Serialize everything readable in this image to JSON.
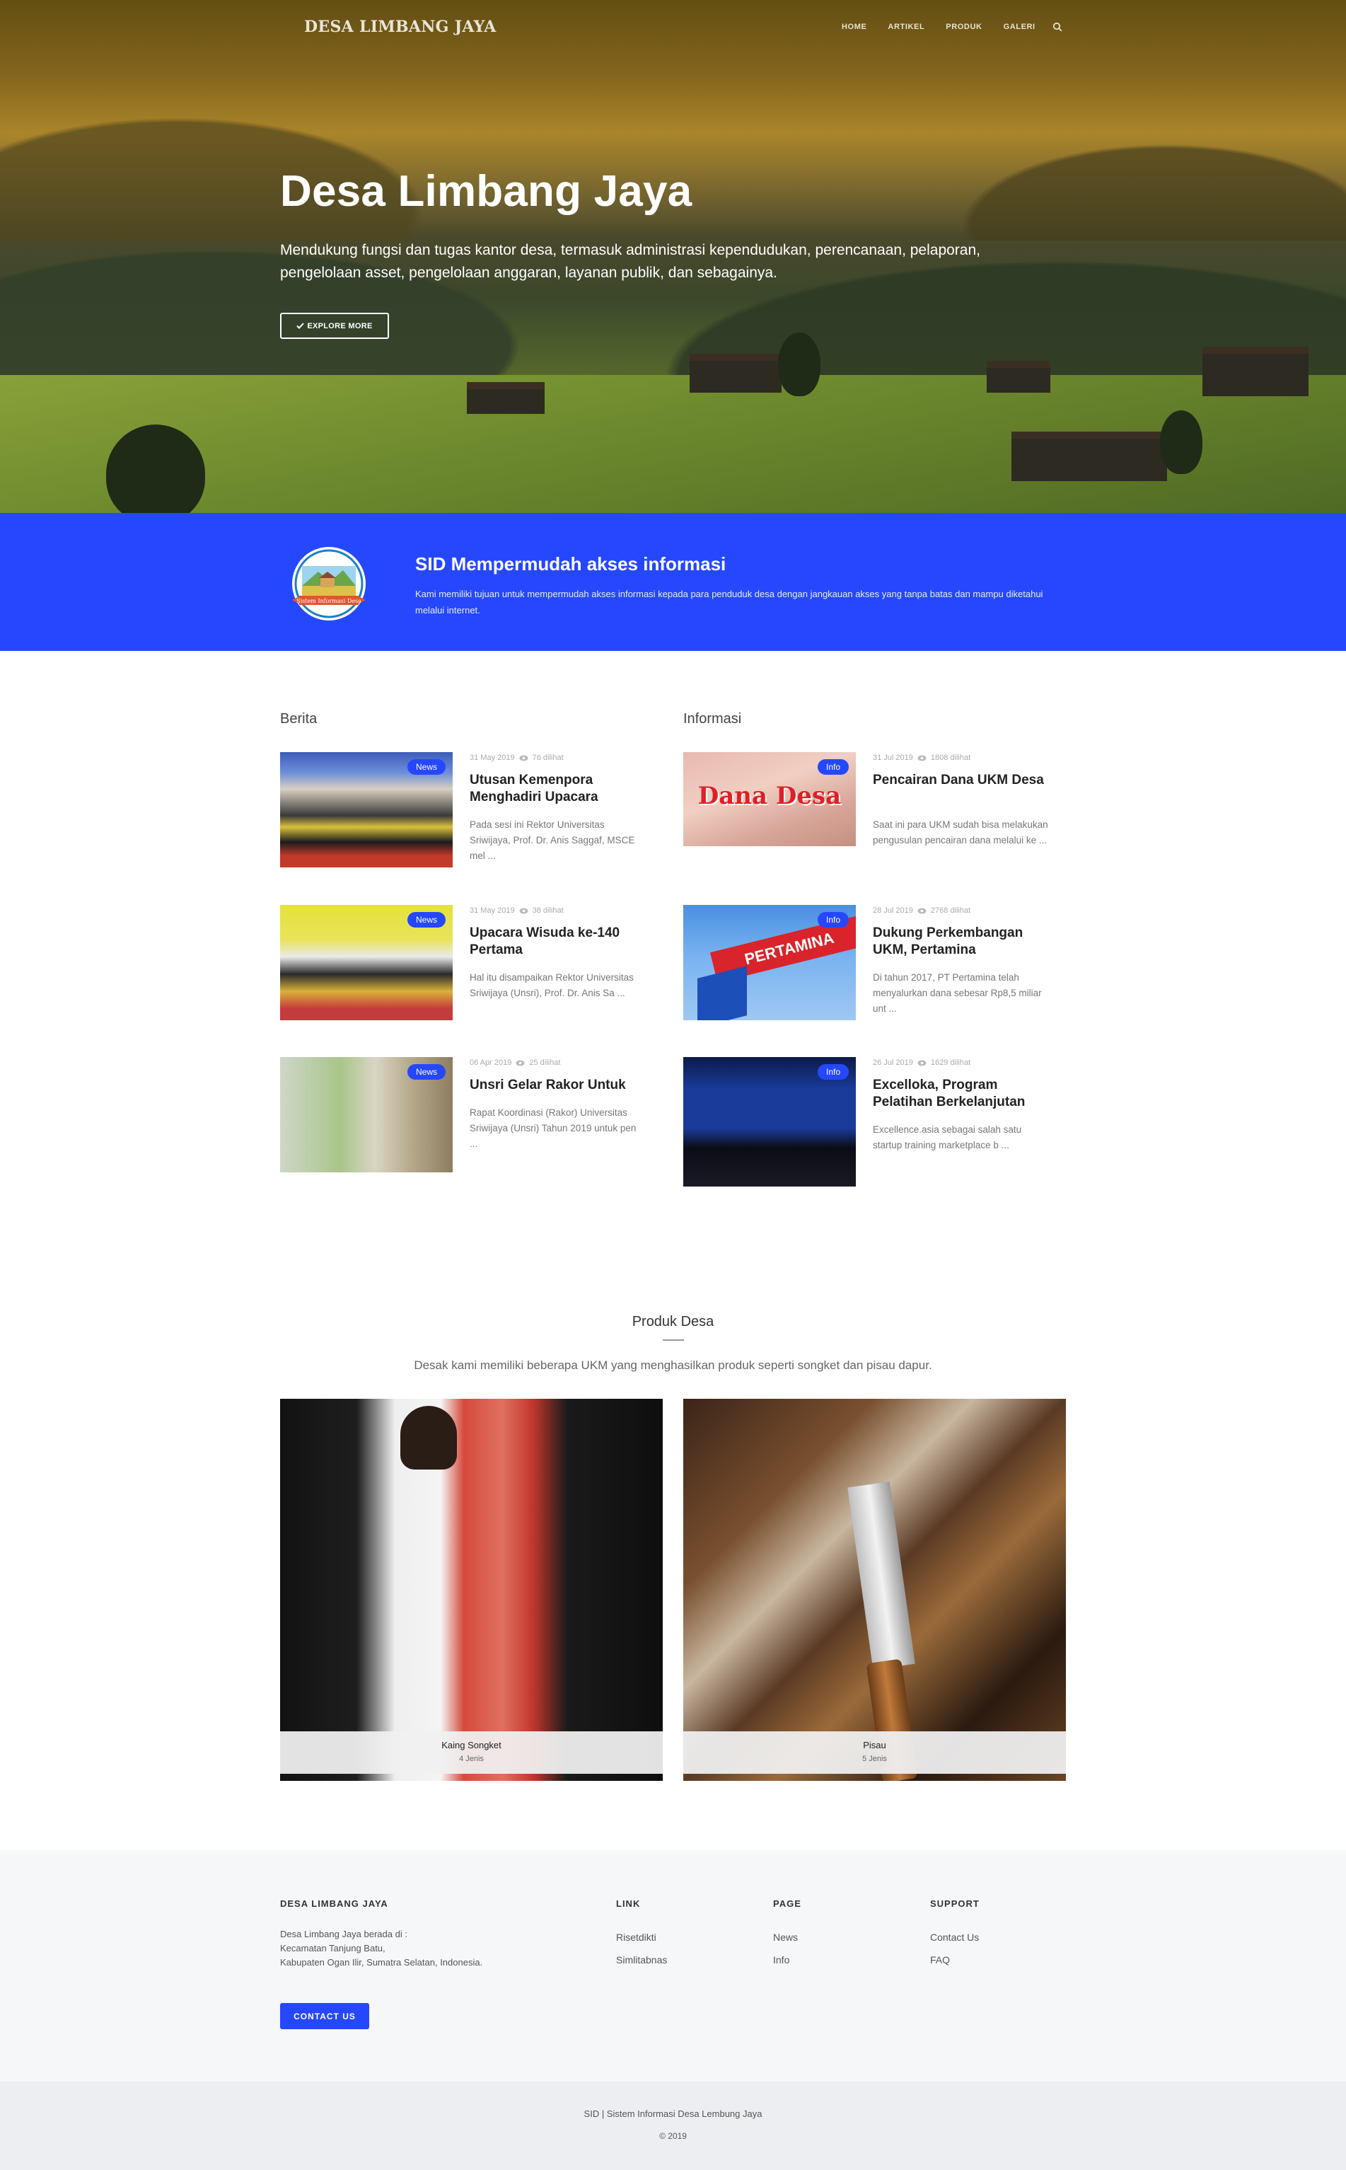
{
  "nav": {
    "brand": "DESA LIMBANG JAYA",
    "items": [
      "HOME",
      "ARTIKEL",
      "PRODUK",
      "GALERI"
    ],
    "search_icon": "search-icon"
  },
  "hero": {
    "title": "Desa Limbang Jaya",
    "text": "Mendukung fungsi dan tugas kantor desa, termasuk administrasi kependudukan, perencanaan, pelaporan, pengelolaan asset, pengelolaan anggaran, layanan publik, dan sebagainya.",
    "button": "EXPLORE MORE",
    "button_icon": "check-icon"
  },
  "band": {
    "title": "SID Mempermudah akses informasi",
    "text": "Kami memiliki tujuan untuk mempermudah akses informasi kepada para penduduk desa dengan jangkauan akses yang tanpa batas dan mampu diketahui melalui internet.",
    "logo_text": "Sistem Informasi Desa",
    "accent": "#2548ff"
  },
  "berita": {
    "heading": "Berita",
    "items": [
      {
        "badge": "News",
        "date": "31 May 2019",
        "views": "76 dilihat",
        "title": "Utusan Kemenpora Menghadiri Upacara",
        "excerpt": "Pada sesi ini Rektor Universitas Sriwijaya, Prof. Dr. Anis Saggaf, MSCE mel ..."
      },
      {
        "badge": "News",
        "date": "31 May 2019",
        "views": "38 dilihat",
        "title": "Upacara Wisuda ke-140 Pertama",
        "excerpt": "Hal itu disampaikan Rektor Universitas Sriwijaya (Unsri), Prof. Dr. Anis Sa ..."
      },
      {
        "badge": "News",
        "date": "06 Apr 2019",
        "views": "25 dilihat",
        "title": "Unsri Gelar Rakor Untuk",
        "excerpt": "Rapat Koordinasi (Rakor) Universitas Sriwijaya (Unsri) Tahun 2019 untuk pen ..."
      }
    ]
  },
  "informasi": {
    "heading": "Informasi",
    "items": [
      {
        "badge": "Info",
        "date": "31 Jul 2019",
        "views": "1808 dilihat",
        "title": "Pencairan Dana UKM Desa",
        "excerpt": "Saat ini para UKM sudah bisa melakukan pengusulan pencairan dana melalui ke ...",
        "image_text": "Dana Desa"
      },
      {
        "badge": "Info",
        "date": "28 Jul 2019",
        "views": "2768 dilihat",
        "title": "Dukung Perkembangan UKM, Pertamina",
        "excerpt": "Di tahun 2017, PT Pertamina telah menyalurkan dana sebesar Rp8,5 miliar unt ...",
        "image_text": "PERTAMINA"
      },
      {
        "badge": "Info",
        "date": "26 Jul 2019",
        "views": "1629 dilihat",
        "title": "Excelloka, Program Pelatihan Berkelanjutan",
        "excerpt": "Excellence.asia sebagai salah satu startup training marketplace b ..."
      }
    ]
  },
  "produk": {
    "title": "Produk Desa",
    "subtitle": "Desak kami memiliki beberapa UKM yang menghasilkan produk seperti songket dan pisau dapur.",
    "items": [
      {
        "name": "Kaing Songket",
        "count": "4 Jenis"
      },
      {
        "name": "Pisau",
        "count": "5 Jenis"
      }
    ]
  },
  "footer": {
    "about_heading": "DESA LIMBANG JAYA",
    "about_lines": [
      "Desa Limbang Jaya berada di :",
      "Kecamatan Tanjung Batu,",
      "Kabupaten Ogan Ilir, Sumatra Selatan, Indonesia."
    ],
    "contact_button": "CONTACT US",
    "link_heading": "LINK",
    "links": [
      "Risetdikti",
      "Simlitabnas"
    ],
    "page_heading": "PAGE",
    "pages": [
      "News",
      "Info"
    ],
    "support_heading": "SUPPORT",
    "support": [
      "Contact Us",
      "FAQ"
    ],
    "copyright": "SID | Sistem Informasi Desa Lembung Jaya",
    "year": "© 2019"
  }
}
